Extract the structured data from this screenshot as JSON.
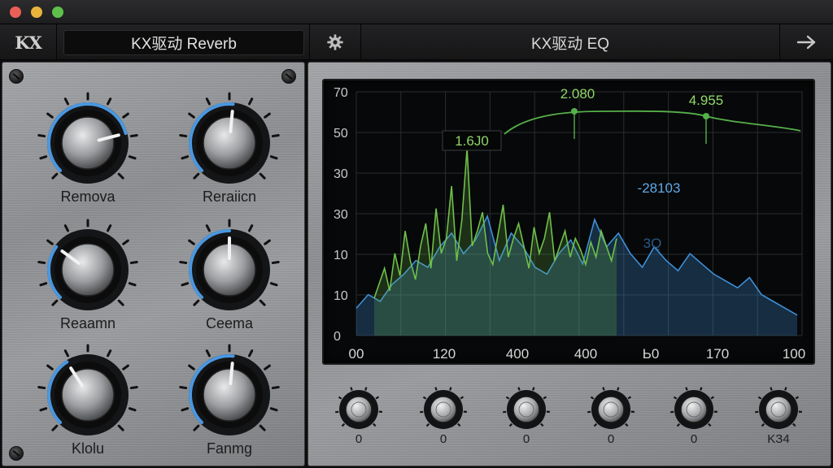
{
  "window": {
    "controls": [
      "close",
      "minimize",
      "zoom"
    ]
  },
  "toolbar": {
    "logo": "KX",
    "preset_name": "KX驱动 Reverb",
    "settings_icon": "gear-icon",
    "eq_title": "KX驱动 EQ",
    "next_icon": "arrow-right-icon"
  },
  "knobs": [
    {
      "label": "Remova",
      "value": 0.78
    },
    {
      "label": "Reraiicn",
      "value": 0.52
    },
    {
      "label": "Reaamn",
      "value": 0.3
    },
    {
      "label": "Ceema",
      "value": 0.5
    },
    {
      "label": "Klolu",
      "value": 0.38
    },
    {
      "label": "Fanmg",
      "value": 0.52
    }
  ],
  "small_knobs": [
    {
      "label": "0"
    },
    {
      "label": "0"
    },
    {
      "label": "0"
    },
    {
      "label": "0"
    },
    {
      "label": "0"
    },
    {
      "label": "KЗ4"
    }
  ],
  "chart_data": {
    "type": "area",
    "y_ticks": [
      "70",
      "50",
      "30",
      "30",
      "10",
      "10",
      "0"
    ],
    "x_ticks": [
      "00",
      "120",
      "400",
      "400",
      "Ь0",
      "170",
      "100"
    ],
    "annotations": [
      "1.6J0",
      "2.080",
      "4.955",
      "-28103",
      "3Q"
    ],
    "series": [
      {
        "color": "#6fc04a",
        "values": [
          10,
          14,
          18,
          12,
          22,
          16,
          28,
          20,
          15,
          24,
          30,
          18,
          34,
          22,
          26,
          40,
          20,
          31,
          50,
          24,
          28,
          33,
          22,
          19,
          27,
          35,
          21,
          26,
          30,
          24,
          18,
          29,
          22,
          26,
          33,
          20,
          24,
          28,
          21,
          26,
          23,
          19,
          25,
          21,
          28,
          24,
          20,
          26
        ]
      },
      {
        "color": "#3e8fd6",
        "values": [
          8,
          12,
          10,
          15,
          18,
          22,
          20,
          26,
          30,
          24,
          28,
          35,
          22,
          30,
          26,
          20,
          18,
          24,
          28,
          21,
          34,
          26,
          30,
          24,
          20,
          26,
          22,
          19,
          24,
          21,
          18,
          16,
          14,
          17,
          12,
          10,
          8,
          6
        ]
      }
    ],
    "eq_curve_color": "#55b04a",
    "grid": true
  }
}
